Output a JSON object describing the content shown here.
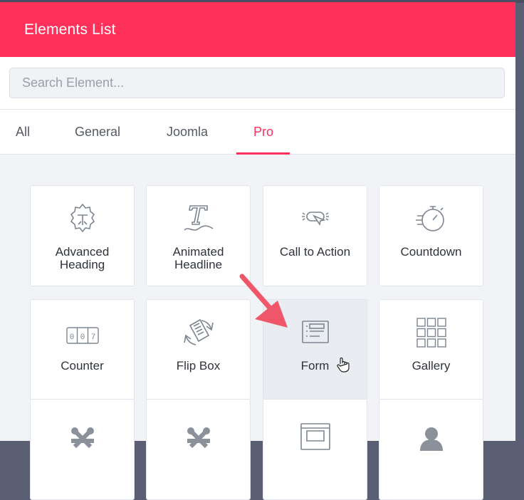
{
  "header": {
    "title": "Elements List"
  },
  "search": {
    "placeholder": "Search Element..."
  },
  "tabs": [
    {
      "label": "All"
    },
    {
      "label": "General"
    },
    {
      "label": "Joomla"
    },
    {
      "label": "Pro",
      "active": true
    }
  ],
  "elements": [
    {
      "label": "Advanced Heading",
      "icon": "advanced-heading-icon"
    },
    {
      "label": "Animated Headline",
      "icon": "animated-headline-icon"
    },
    {
      "label": "Call to Action",
      "icon": "call-to-action-icon"
    },
    {
      "label": "Countdown",
      "icon": "countdown-icon"
    },
    {
      "label": "Counter",
      "icon": "counter-icon"
    },
    {
      "label": "Flip Box",
      "icon": "flip-box-icon"
    },
    {
      "label": "Form",
      "icon": "form-icon",
      "hovered": true
    },
    {
      "label": "Gallery",
      "icon": "gallery-icon"
    },
    {
      "label": "",
      "icon": "joomla-icon"
    },
    {
      "label": "",
      "icon": "joomla-icon"
    },
    {
      "label": "",
      "icon": "layout-icon"
    },
    {
      "label": "",
      "icon": "user-icon"
    }
  ],
  "counter_digits": [
    "0",
    "0",
    "7"
  ],
  "colors": {
    "accent": "#ff305a",
    "icon": "#7d8590",
    "arrow": "#f0566a"
  }
}
